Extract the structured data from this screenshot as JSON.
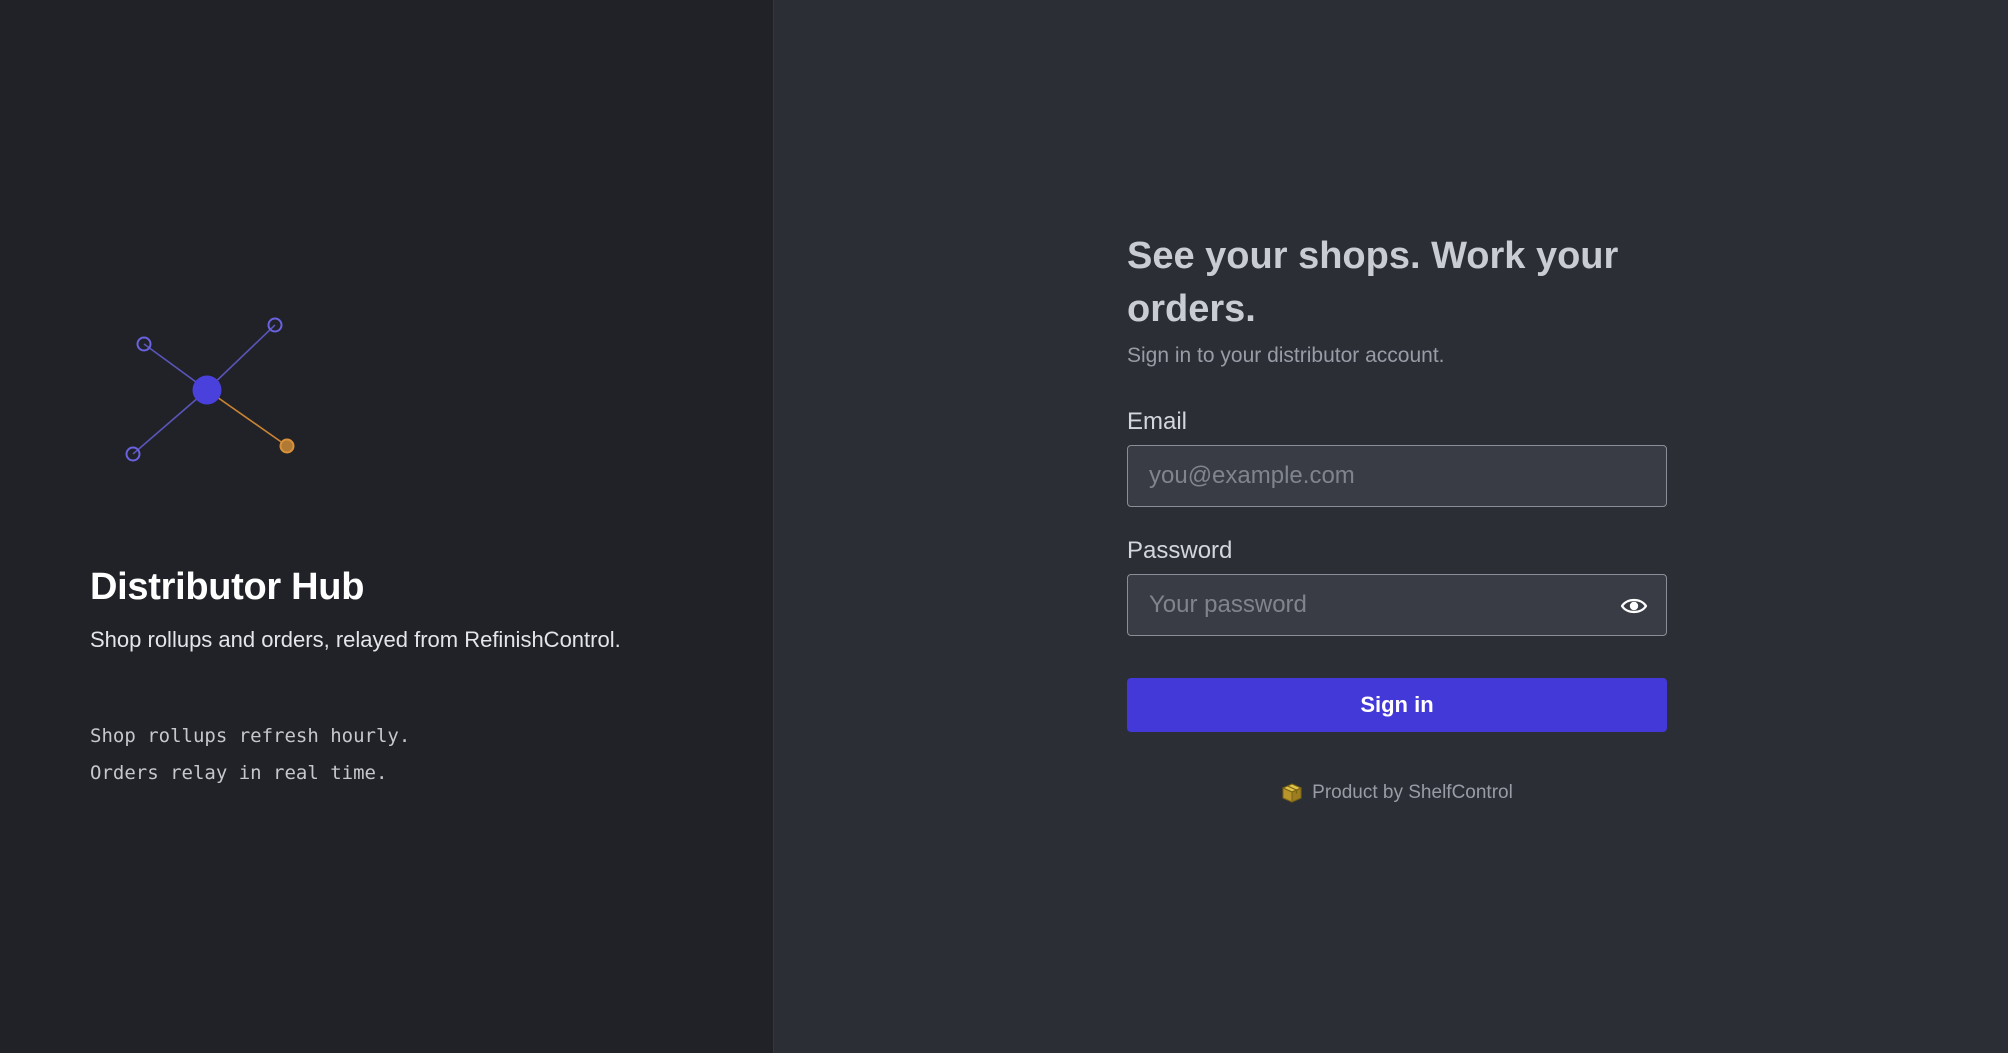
{
  "brand": {
    "title": "Distributor Hub",
    "tagline": "Shop rollups and orders, relayed from RefinishControl.",
    "notes": [
      "Shop rollups refresh hourly.",
      "Orders relay in real time."
    ],
    "graphic_icon": "network-hub-icon"
  },
  "login": {
    "headline": "See your shops. Work your orders.",
    "subheadline": "Sign in to your distributor account.",
    "email": {
      "label": "Email",
      "placeholder": "you@example.com",
      "value": ""
    },
    "password": {
      "label": "Password",
      "placeholder": "Your password",
      "value": "",
      "toggle_icon": "eye-icon"
    },
    "submit_label": "Sign in",
    "footer_text": "Product by ShelfControl",
    "footer_icon": "package-icon"
  },
  "colors": {
    "accent": "#4338d8",
    "left_panel_bg": "#202227",
    "right_panel_bg": "#2b2e34",
    "node_purple": "#6a62e0",
    "node_orange": "#d9913a",
    "package_yellow": "#c9a227"
  }
}
